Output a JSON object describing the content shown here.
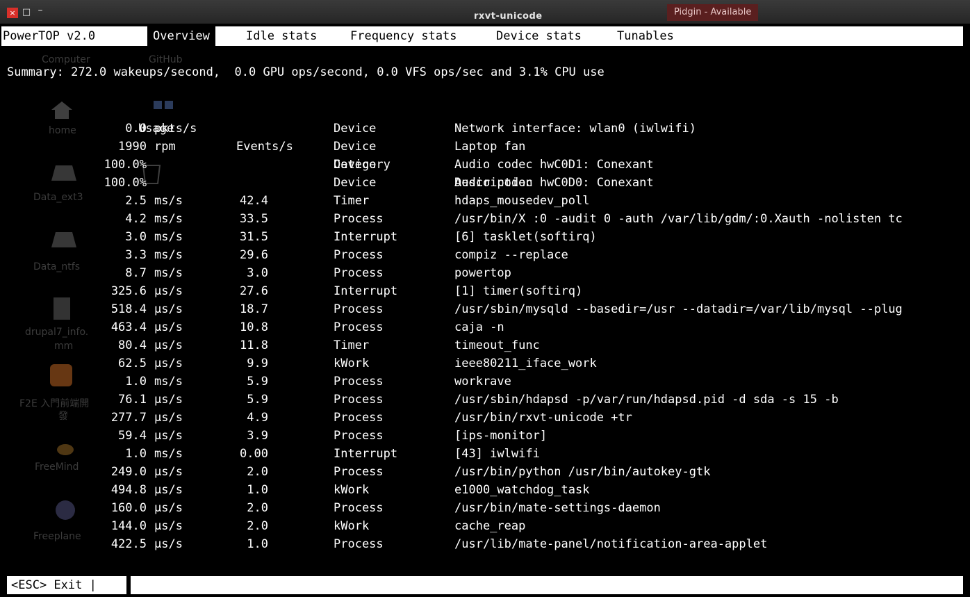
{
  "window": {
    "title": "rxvt-unicode",
    "close_glyph": "×",
    "max_glyph": "□",
    "min_glyph": "–",
    "notification": "Pidgin - Available"
  },
  "tabs": {
    "app": "PowerTOP v2.0",
    "items": [
      "Overview",
      "Idle stats",
      "Frequency stats",
      "Device stats",
      "Tunables"
    ],
    "active": "Overview"
  },
  "summary": "Summary: 272.0 wakeups/second,  0.0 GPU ops/second, 0.0 VFS ops/sec and 3.1% CPU use",
  "table": {
    "headers": {
      "usage": "Usage",
      "events": "Events/s",
      "category": "Category",
      "description": "Description"
    },
    "rows": [
      {
        "usage": "0.0",
        "unit": "pkts/s",
        "events": "",
        "category": "Device",
        "description": "Network interface: wlan0 (iwlwifi)"
      },
      {
        "usage": "1990",
        "unit": "rpm",
        "events": "",
        "category": "Device",
        "description": "Laptop fan"
      },
      {
        "usage": "100.0%",
        "unit": "",
        "events": "",
        "category": "Device",
        "description": "Audio codec hwC0D1: Conexant"
      },
      {
        "usage": "100.0%",
        "unit": "",
        "events": "",
        "category": "Device",
        "description": "Audio codec hwC0D0: Conexant"
      },
      {
        "usage": "2.5",
        "unit": "ms/s",
        "events": "42.4",
        "category": "Timer",
        "description": "hdaps_mousedev_poll"
      },
      {
        "usage": "4.2",
        "unit": "ms/s",
        "events": "33.5",
        "category": "Process",
        "description": "/usr/bin/X :0 -audit 0 -auth /var/lib/gdm/:0.Xauth -nolisten tc"
      },
      {
        "usage": "3.0",
        "unit": "ms/s",
        "events": "31.5",
        "category": "Interrupt",
        "description": "[6] tasklet(softirq)"
      },
      {
        "usage": "3.3",
        "unit": "ms/s",
        "events": "29.6",
        "category": "Process",
        "description": "compiz --replace"
      },
      {
        "usage": "8.7",
        "unit": "ms/s",
        "events": "3.0",
        "category": "Process",
        "description": "powertop"
      },
      {
        "usage": "325.6",
        "unit": "µs/s",
        "events": "27.6",
        "category": "Interrupt",
        "description": "[1] timer(softirq)"
      },
      {
        "usage": "518.4",
        "unit": "µs/s",
        "events": "18.7",
        "category": "Process",
        "description": "/usr/sbin/mysqld --basedir=/usr --datadir=/var/lib/mysql --plug"
      },
      {
        "usage": "463.4",
        "unit": "µs/s",
        "events": "10.8",
        "category": "Process",
        "description": "caja -n"
      },
      {
        "usage": "80.4",
        "unit": "µs/s",
        "events": "11.8",
        "category": "Timer",
        "description": "timeout_func"
      },
      {
        "usage": "62.5",
        "unit": "µs/s",
        "events": "9.9",
        "category": "kWork",
        "description": "ieee80211_iface_work"
      },
      {
        "usage": "1.0",
        "unit": "ms/s",
        "events": "5.9",
        "category": "Process",
        "description": "workrave"
      },
      {
        "usage": "76.1",
        "unit": "µs/s",
        "events": "5.9",
        "category": "Process",
        "description": "/usr/sbin/hdapsd -p/var/run/hdapsd.pid -d sda -s 15 -b"
      },
      {
        "usage": "277.7",
        "unit": "µs/s",
        "events": "4.9",
        "category": "Process",
        "description": "/usr/bin/rxvt-unicode +tr"
      },
      {
        "usage": "59.4",
        "unit": "µs/s",
        "events": "3.9",
        "category": "Process",
        "description": "[ips-monitor]"
      },
      {
        "usage": "1.0",
        "unit": "ms/s",
        "events": "0.00",
        "category": "Interrupt",
        "description": "[43] iwlwifi"
      },
      {
        "usage": "249.0",
        "unit": "µs/s",
        "events": "2.0",
        "category": "Process",
        "description": "/usr/bin/python /usr/bin/autokey-gtk"
      },
      {
        "usage": "494.8",
        "unit": "µs/s",
        "events": "1.0",
        "category": "kWork",
        "description": "e1000_watchdog_task"
      },
      {
        "usage": "160.0",
        "unit": "µs/s",
        "events": "2.0",
        "category": "Process",
        "description": "/usr/bin/mate-settings-daemon"
      },
      {
        "usage": "144.0",
        "unit": "µs/s",
        "events": "2.0",
        "category": "kWork",
        "description": "cache_reap"
      },
      {
        "usage": "422.5",
        "unit": "µs/s",
        "events": "1.0",
        "category": "Process",
        "description": "/usr/lib/mate-panel/notification-area-applet"
      }
    ]
  },
  "statusbar": {
    "exit_label": "<ESC> Exit |"
  },
  "desktop_ghosts": {
    "items": [
      "Computer",
      "GitHub",
      "home",
      "Data_ext3",
      "Data_ntfs",
      "drupal7_info.",
      "mm",
      "F2E 入門前端開",
      "發",
      "FreeMind",
      "Freeplane"
    ]
  },
  "colors": {
    "background": "#000000",
    "foreground": "#ffffff",
    "tabbar": "#ffffff",
    "close_button": "#d8302a",
    "notification_bg": "#5a1f1f"
  }
}
